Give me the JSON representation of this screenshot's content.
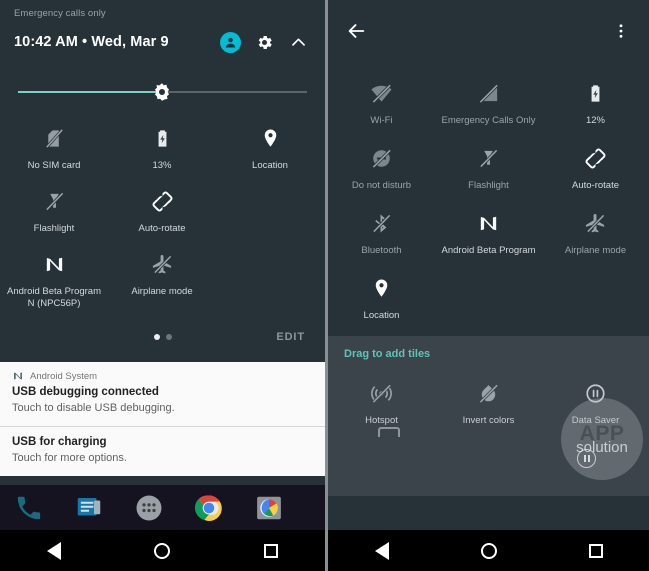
{
  "left_panel": {
    "carrier_status": "Emergency calls only",
    "clock": "10:42 AM  •  Wed, Mar 9",
    "header_icons": [
      {
        "name": "user-avatar-icon",
        "label": "User"
      },
      {
        "name": "settings-gear-icon",
        "label": "Settings"
      },
      {
        "name": "collapse-chevron-up-icon",
        "label": "Collapse"
      }
    ],
    "brightness": {
      "label": "Brightness",
      "value_percent": 45
    },
    "tiles": [
      {
        "icon": "sim-card-off-icon",
        "label": "No SIM card",
        "state": "off"
      },
      {
        "icon": "battery-charging-icon",
        "label": "13%",
        "state": "on"
      },
      {
        "icon": "location-pin-icon",
        "label": "Location",
        "state": "on"
      },
      {
        "icon": "flashlight-off-icon",
        "label": "Flashlight",
        "state": "off"
      },
      {
        "icon": "auto-rotate-icon",
        "label": "Auto-rotate",
        "state": "on"
      },
      {
        "icon": "android-beta-n-icon",
        "label": "Android Beta Program\nN (NPC56P)",
        "state": "on"
      },
      {
        "icon": "airplane-mode-off-icon",
        "label": "Airplane mode",
        "state": "off"
      }
    ],
    "tile_labels": {
      "no_sim": "No SIM card",
      "battery": "13%",
      "location": "Location",
      "flashlight": "Flashlight",
      "auto_rotate": "Auto-rotate",
      "beta_line1": "Android Beta Program",
      "beta_line2": "N (NPC56P)",
      "airplane": "Airplane mode"
    },
    "pagination": {
      "pages": 2,
      "current": 1
    },
    "edit_label": "EDIT",
    "notifications": [
      {
        "app_icon": "android-n-icon",
        "app_name": "Android System",
        "title": "USB debugging connected",
        "body": "Touch to disable USB debugging."
      },
      {
        "app_icon": "android-n-icon",
        "app_name": "",
        "title": "USB for charging",
        "body": "Touch for more options."
      }
    ],
    "dock": [
      {
        "icon": "phone-icon",
        "label": "Phone"
      },
      {
        "icon": "messages-icon",
        "label": "Messages"
      },
      {
        "icon": "app-drawer-icon",
        "label": "All apps"
      },
      {
        "icon": "chrome-icon",
        "label": "Chrome"
      },
      {
        "icon": "photos-camera-icon",
        "label": "Photos"
      }
    ]
  },
  "right_panel": {
    "header": {
      "back_icon": "back-arrow-icon",
      "overflow_icon": "overflow-menu-icon"
    },
    "active_tiles": [
      {
        "icon": "wifi-off-icon",
        "label": "Wi-Fi",
        "state": "off"
      },
      {
        "icon": "signal-off-icon",
        "label": "Emergency Calls Only",
        "state": "off"
      },
      {
        "icon": "battery-charging-icon",
        "label": "12%",
        "state": "on"
      },
      {
        "icon": "do-not-disturb-off-icon",
        "label": "Do not disturb",
        "state": "off"
      },
      {
        "icon": "flashlight-off-icon",
        "label": "Flashlight",
        "state": "off"
      },
      {
        "icon": "auto-rotate-icon",
        "label": "Auto-rotate",
        "state": "on"
      },
      {
        "icon": "bluetooth-off-icon",
        "label": "Bluetooth",
        "state": "off"
      },
      {
        "icon": "android-beta-n-icon",
        "label": "Android Beta Program",
        "state": "on"
      },
      {
        "icon": "airplane-mode-off-icon",
        "label": "Airplane mode",
        "state": "off"
      },
      {
        "icon": "location-pin-icon",
        "label": "Location",
        "state": "on"
      }
    ],
    "tile_labels": {
      "wifi": "Wi-Fi",
      "emergency": "Emergency Calls Only",
      "battery": "12%",
      "dnd": "Do not disturb",
      "flashlight": "Flashlight",
      "auto_rotate": "Auto-rotate",
      "bluetooth": "Bluetooth",
      "beta": "Android Beta Program",
      "airplane": "Airplane mode",
      "location": "Location"
    },
    "drag_section": {
      "header": "Drag to add tiles",
      "tiles": [
        {
          "icon": "hotspot-off-icon",
          "label": "Hotspot"
        },
        {
          "icon": "invert-colors-off-icon",
          "label": "Invert colors"
        },
        {
          "icon": "data-saver-icon",
          "label": "Data Saver"
        }
      ],
      "tile_labels": {
        "hotspot": "Hotspot",
        "invert": "Invert colors",
        "data_saver": "Data Saver"
      }
    }
  },
  "watermark": {
    "line1": "APP",
    "line2": "solution"
  },
  "navbar": {
    "buttons": [
      {
        "icon": "nav-back-icon",
        "label": "Back"
      },
      {
        "icon": "nav-home-icon",
        "label": "Home"
      },
      {
        "icon": "nav-recents-icon",
        "label": "Recents"
      }
    ]
  },
  "colors": {
    "panel_bg": "#263238",
    "drag_bg": "#3b444b",
    "accent_teal": "#5fc3b8",
    "avatar_cyan": "#00bcd4",
    "tile_label": "#d3d9dc",
    "navbar_bg": "#000000"
  }
}
